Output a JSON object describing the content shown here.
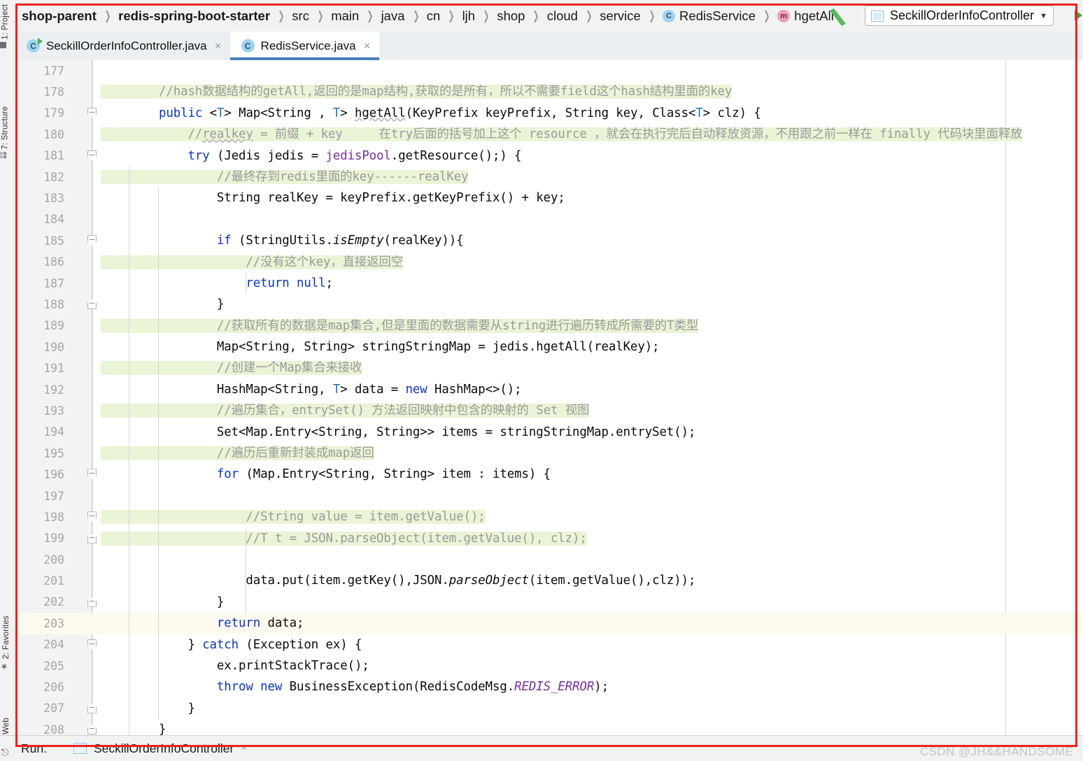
{
  "window": {
    "ide": "IntelliJ IDEA",
    "watermark": "CSDN @JH&&HANDSOME"
  },
  "toolstrip": {
    "items": [
      {
        "label": "1: Project",
        "icon": "project-icon"
      },
      {
        "label": "7: Structure",
        "icon": "structure-icon"
      },
      {
        "label": "2: Favorites",
        "icon": "star-icon"
      },
      {
        "label": "Web",
        "icon": "web-icon"
      }
    ]
  },
  "breadcrumb": {
    "items": [
      {
        "label": "shop-parent",
        "bold": true,
        "badge": ""
      },
      {
        "label": "redis-spring-boot-starter",
        "bold": true,
        "badge": ""
      },
      {
        "label": "src",
        "bold": false,
        "badge": ""
      },
      {
        "label": "main",
        "bold": false,
        "badge": ""
      },
      {
        "label": "java",
        "bold": false,
        "badge": ""
      },
      {
        "label": "cn",
        "bold": false,
        "badge": ""
      },
      {
        "label": "ljh",
        "bold": false,
        "badge": ""
      },
      {
        "label": "shop",
        "bold": false,
        "badge": ""
      },
      {
        "label": "cloud",
        "bold": false,
        "badge": ""
      },
      {
        "label": "service",
        "bold": false,
        "badge": ""
      },
      {
        "label": "RedisService",
        "bold": false,
        "badge": "C"
      },
      {
        "label": "hgetAll",
        "bold": false,
        "badge": "m"
      }
    ],
    "separator": "〉"
  },
  "run_config": {
    "label": "SeckillOrderInfoController",
    "caret": "▼",
    "icon": "application-icon",
    "run_button": "run-triangle-icon"
  },
  "tabs": [
    {
      "label": "SeckillOrderInfoController.java",
      "active": false,
      "close": "×",
      "icon": "java-class-runnable-icon"
    },
    {
      "label": "RedisService.java",
      "active": true,
      "close": "×",
      "icon": "java-class-icon"
    }
  ],
  "editor": {
    "first_line": 177,
    "caret_line": 203,
    "lines": [
      {
        "n": 177,
        "fold": "",
        "html": ""
      },
      {
        "n": 178,
        "fold": "",
        "html": "<span class=\"cmt\">        //hash数据结构的getAll,返回的是map结构,获取的是所有，所以不需要field这个hash结构里面的key</span>"
      },
      {
        "n": 179,
        "fold": "open",
        "html": "        <span class=\"kw\">public</span> &lt;<span class=\"typ\">T</span>&gt; Map&lt;String , <span class=\"typ\">T</span>&gt; <span class=\"wavy\">hgetAll</span>(KeyPrefix keyPrefix, String key, Class&lt;<span class=\"typ\">T</span>&gt; clz) {"
      },
      {
        "n": 180,
        "fold": "",
        "html": "<span class=\"cmt\">            //<span class=\"wavy\">realkey</span> = 前缀 + key     在try后面的括号加上这个 resource ，就会在执行完后自动释放资源，不用跟之前一样在 finally 代码块里面释放</span>"
      },
      {
        "n": 181,
        "fold": "open",
        "html": "            <span class=\"kw\">try</span> (Jedis jedis = <span class=\"fld\">jedisPool</span>.getResource();) {"
      },
      {
        "n": 182,
        "fold": "",
        "html": "<span class=\"cmt\">                //最终存到redis里面的key------realKey</span>"
      },
      {
        "n": 183,
        "fold": "",
        "html": "                String realKey = keyPrefix.getKeyPrefix() + key;"
      },
      {
        "n": 184,
        "fold": "",
        "html": ""
      },
      {
        "n": 185,
        "fold": "open",
        "html": "                <span class=\"kw\">if</span> (StringUtils.<span class=\"ital\">isEmpty</span>(realKey)){"
      },
      {
        "n": 186,
        "fold": "",
        "html": "<span class=\"cmt\">                    //没有这个key，直接返回空</span>"
      },
      {
        "n": 187,
        "fold": "",
        "html": "                    <span class=\"kw\">return</span> <span class=\"kw\">null</span>;"
      },
      {
        "n": 188,
        "fold": "close",
        "html": "                }"
      },
      {
        "n": 189,
        "fold": "",
        "html": "<span class=\"cmt\">                //获取所有的数据是map集合,但是里面的数据需要从string进行遍历转成所需要的T类型</span>"
      },
      {
        "n": 190,
        "fold": "",
        "html": "                Map&lt;String, String&gt; stringStringMap = jedis.hgetAll(realKey);"
      },
      {
        "n": 191,
        "fold": "",
        "html": "<span class=\"cmt\">                //创建一个Map集合来接收</span>"
      },
      {
        "n": 192,
        "fold": "",
        "html": "                HashMap&lt;String, <span class=\"typ\">T</span>&gt; data = <span class=\"kw\">new</span> HashMap&lt;&gt;();"
      },
      {
        "n": 193,
        "fold": "",
        "html": "<span class=\"cmt\">                //遍历集合，entrySet() 方法返回映射中包含的映射的 Set 视图</span>"
      },
      {
        "n": 194,
        "fold": "",
        "html": "                Set&lt;Map.Entry&lt;String, String&gt;&gt; items = stringStringMap.entrySet();"
      },
      {
        "n": 195,
        "fold": "",
        "html": "<span class=\"cmt\">                //遍历后重新封装成map返回</span>"
      },
      {
        "n": 196,
        "fold": "open",
        "html": "                <span class=\"kw\">for</span> (Map.Entry&lt;String, String&gt; item : items) {"
      },
      {
        "n": 197,
        "fold": "",
        "html": ""
      },
      {
        "n": 198,
        "fold": "open",
        "html": "<span class=\"cmt\">                    //String value = item.getValue();</span>"
      },
      {
        "n": 199,
        "fold": "close",
        "html": "<span class=\"cmt\">                    //T t = JSON.parseObject(item.getValue(), clz);</span>"
      },
      {
        "n": 200,
        "fold": "",
        "html": ""
      },
      {
        "n": 201,
        "fold": "",
        "html": "                    data.put(item.getKey(),JSON.<span class=\"ital\">parseObject</span>(item.getValue(),clz));"
      },
      {
        "n": 202,
        "fold": "close",
        "html": "                }"
      },
      {
        "n": 203,
        "fold": "",
        "html": "                <span class=\"kw\">return</span> data;"
      },
      {
        "n": 204,
        "fold": "open",
        "html": "            } <span class=\"kw\">catch</span> (Exception ex) {"
      },
      {
        "n": 205,
        "fold": "",
        "html": "                ex.printStackTrace();"
      },
      {
        "n": 206,
        "fold": "",
        "html": "                <span class=\"kw\">throw</span> <span class=\"kw\">new</span> BusinessException(RedisCodeMsg.<span class=\"fld ital\">REDIS_ERROR</span>);"
      },
      {
        "n": 207,
        "fold": "close",
        "html": "            }"
      },
      {
        "n": 208,
        "fold": "close",
        "html": "        }"
      }
    ]
  },
  "statusbar": {
    "run_label": "Run:",
    "run_tab": "SeckillOrderInfoController",
    "close": "×"
  },
  "colors": {
    "accent_blue": "#4a7fc1",
    "comment_highlight": "#eaf4d6",
    "keyword": "#0d35c0",
    "field": "#7a2f9e",
    "annotation_red": "#ef2020",
    "caret_row": "#fcfaef"
  }
}
